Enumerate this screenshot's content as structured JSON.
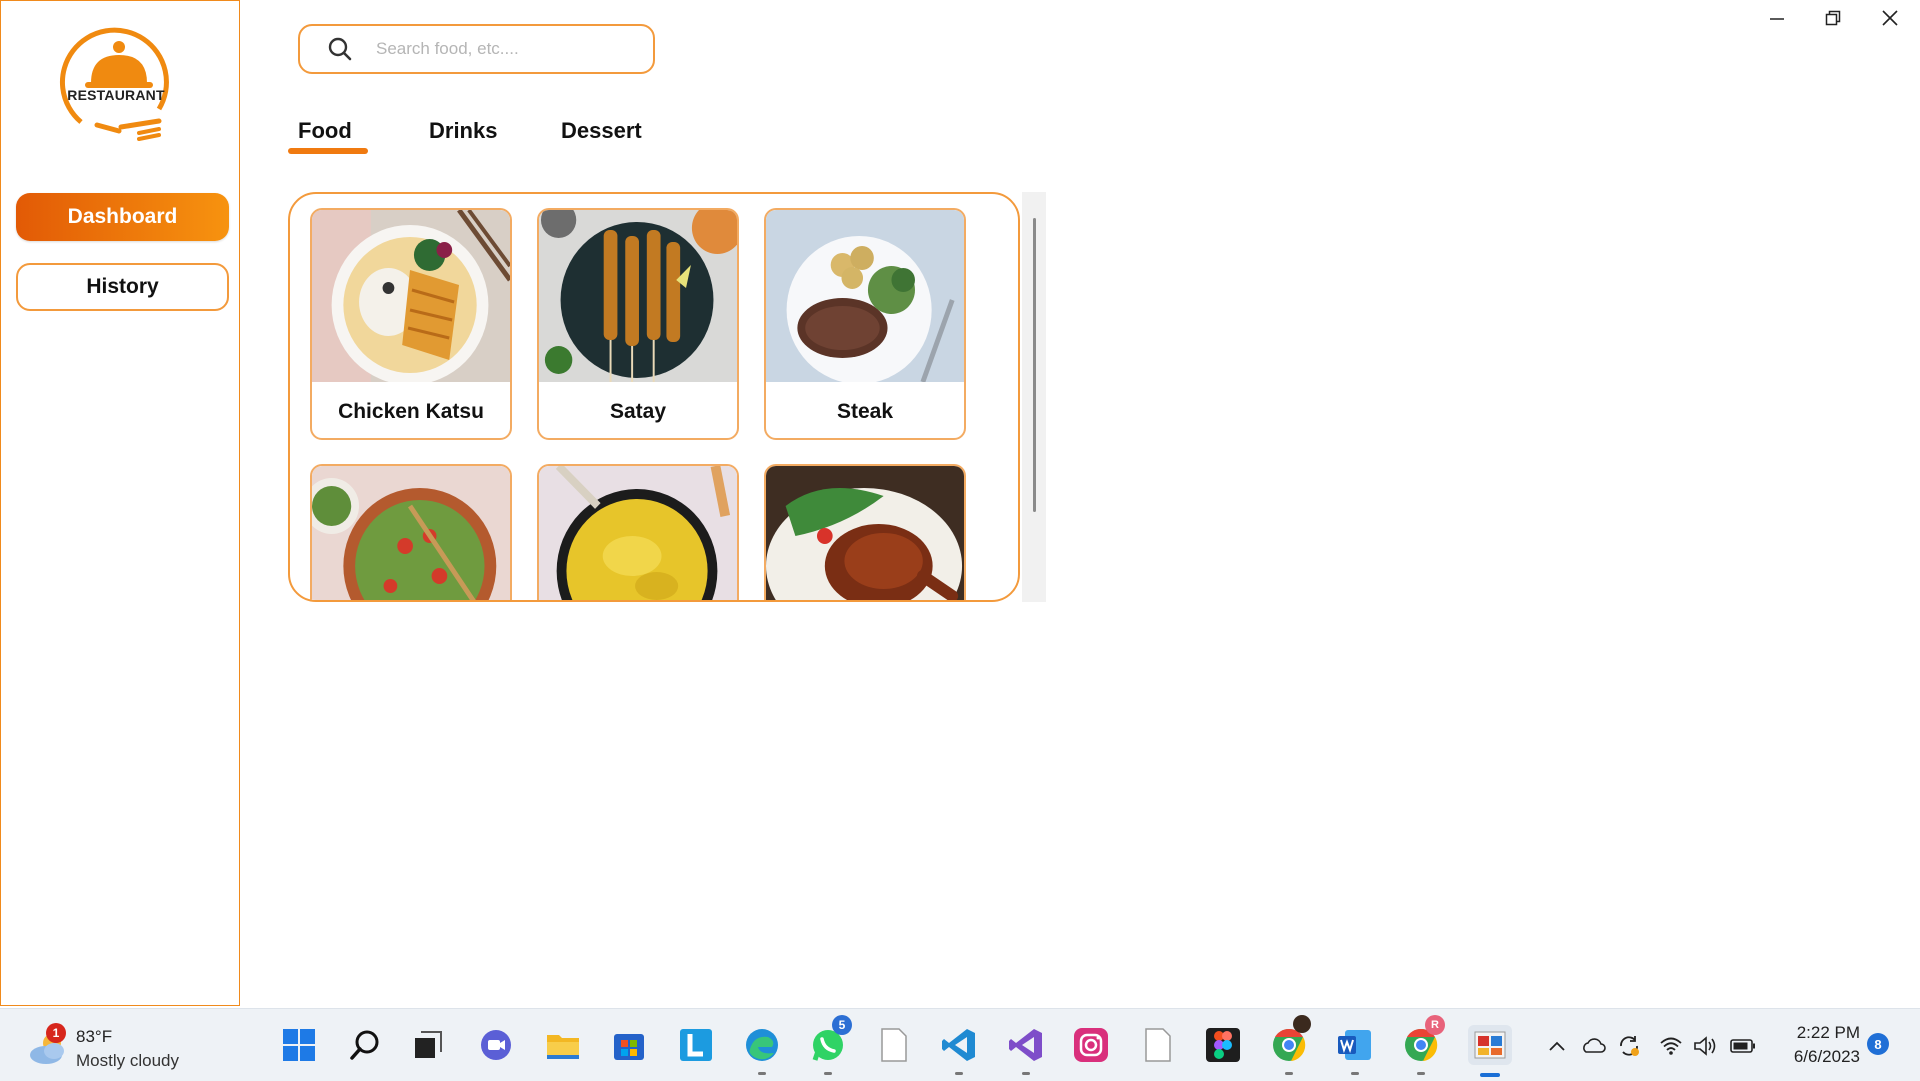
{
  "sidebar": {
    "logo_text": "RESTAURANT",
    "nav": [
      {
        "label": "Dashboard",
        "active": true
      },
      {
        "label": "History",
        "active": false
      }
    ]
  },
  "search": {
    "placeholder": "Search food, etc...."
  },
  "tabs": [
    {
      "label": "Food",
      "active": true
    },
    {
      "label": "Drinks",
      "active": false
    },
    {
      "label": "Dessert",
      "active": false
    }
  ],
  "menu_items": [
    {
      "name": "Chicken Katsu",
      "image": "chicken-katsu-plate"
    },
    {
      "name": "Satay",
      "image": "satay-skewers"
    },
    {
      "name": "Steak",
      "image": "steak-plate"
    },
    {
      "name": "",
      "image": "salad-bowl"
    },
    {
      "name": "",
      "image": "yellow-curry"
    },
    {
      "name": "",
      "image": "grilled-chicken"
    }
  ],
  "window_controls": [
    "minimize-icon",
    "restore-icon",
    "close-icon"
  ],
  "taskbar": {
    "weather": {
      "temp": "83°F",
      "condition": "Mostly cloudy",
      "badge": "1"
    },
    "apps": [
      {
        "name": "windows-start-icon"
      },
      {
        "name": "search-icon"
      },
      {
        "name": "task-view-icon"
      },
      {
        "name": "teams-chat-icon"
      },
      {
        "name": "file-explorer-icon"
      },
      {
        "name": "microsoft-store-icon"
      },
      {
        "name": "l-app-icon"
      },
      {
        "name": "edge-icon"
      },
      {
        "name": "whatsapp-icon",
        "badge": "5"
      },
      {
        "name": "blank-file-icon"
      },
      {
        "name": "vscode-icon"
      },
      {
        "name": "visual-studio-icon"
      },
      {
        "name": "instagram-icon"
      },
      {
        "name": "blank-file-icon"
      },
      {
        "name": "figma-icon"
      },
      {
        "name": "chrome-icon"
      },
      {
        "name": "word-icon"
      },
      {
        "name": "chrome-profile-icon",
        "badge": "R"
      },
      {
        "name": "restaurant-app-icon"
      }
    ],
    "clock": {
      "time": "2:22 PM",
      "date": "6/6/2023"
    },
    "notification_count": "8"
  },
  "colors": {
    "accent": "#f07a10",
    "accent_dark": "#e25a06",
    "border": "#f39a3c",
    "taskbar_bg": "#eef2f6"
  }
}
